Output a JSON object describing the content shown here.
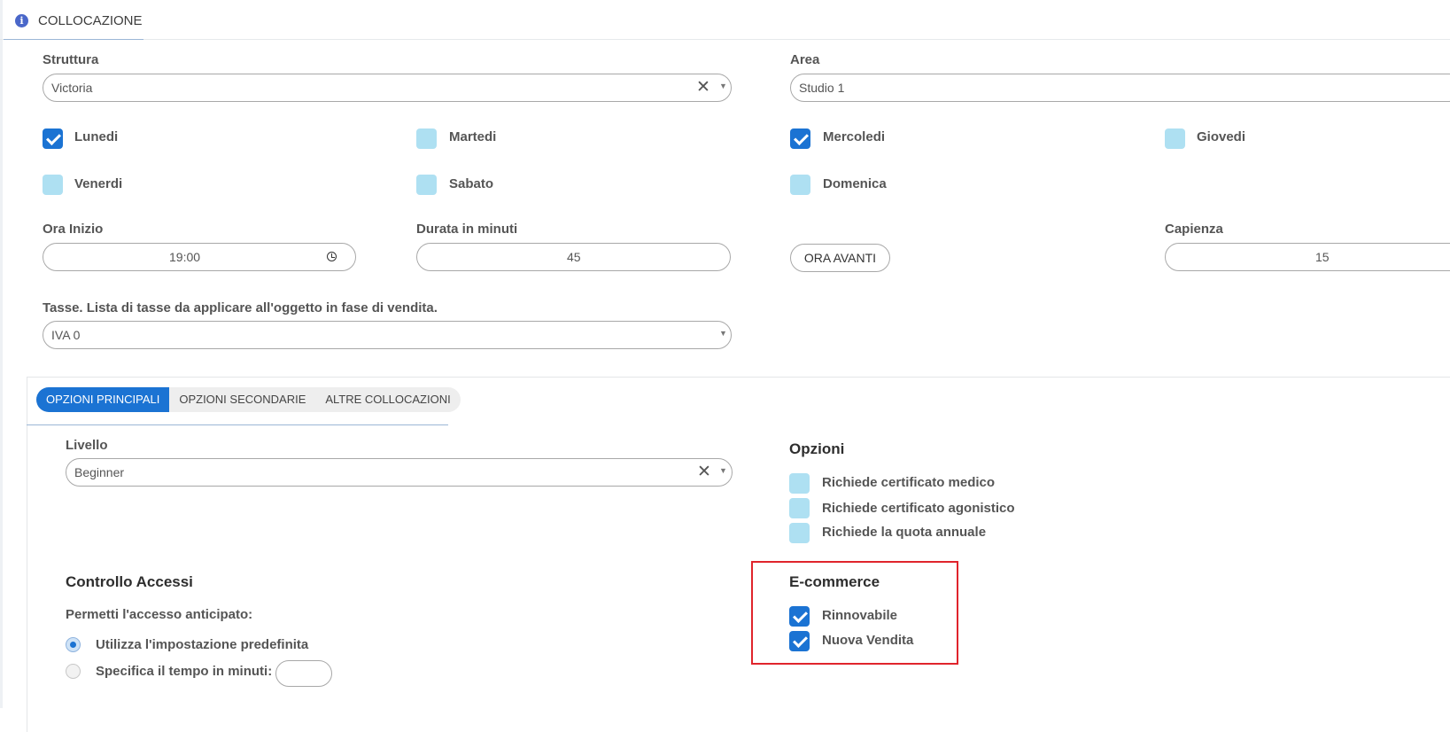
{
  "header": {
    "title": "COLLOCAZIONE",
    "icon": "info-icon"
  },
  "form": {
    "struttura": {
      "label": "Struttura",
      "value": "Victoria"
    },
    "area": {
      "label": "Area",
      "value": "Studio 1"
    },
    "days": [
      {
        "label": "Lunedi",
        "checked": true
      },
      {
        "label": "Martedi",
        "checked": false
      },
      {
        "label": "Mercoledi",
        "checked": true
      },
      {
        "label": "Giovedi",
        "checked": false
      },
      {
        "label": "Venerdi",
        "checked": false
      },
      {
        "label": "Sabato",
        "checked": false
      },
      {
        "label": "Domenica",
        "checked": false
      }
    ],
    "ora_inizio": {
      "label": "Ora Inizio",
      "value": "19:00"
    },
    "durata": {
      "label": "Durata in minuti",
      "value": "45"
    },
    "ora_avanti_button": "ORA AVANTI",
    "capienza": {
      "label": "Capienza",
      "value": "15"
    },
    "tasse": {
      "label": "Tasse. Lista di tasse da applicare all'oggetto in fase di vendita.",
      "value": "IVA 0"
    }
  },
  "tabs": [
    {
      "label": "OPZIONI PRINCIPALI",
      "active": true
    },
    {
      "label": "OPZIONI SECONDARIE",
      "active": false
    },
    {
      "label": "ALTRE COLLOCAZIONI",
      "active": false
    }
  ],
  "livello": {
    "label": "Livello",
    "value": "Beginner"
  },
  "opzioni": {
    "title": "Opzioni",
    "items": [
      {
        "label": "Richiede certificato medico",
        "checked": false
      },
      {
        "label": "Richiede certificato agonistico",
        "checked": false
      },
      {
        "label": "Richiede la quota annuale",
        "checked": false
      }
    ]
  },
  "controllo_accessi": {
    "title": "Controllo Accessi",
    "subtitle": "Permetti l'accesso anticipato:",
    "options": [
      {
        "label": "Utilizza l'impostazione predefinita",
        "selected": true
      },
      {
        "label": "Specifica il tempo in minuti:",
        "selected": false
      }
    ]
  },
  "ecommerce": {
    "title": "E-commerce",
    "items": [
      {
        "label": "Rinnovabile",
        "checked": true
      },
      {
        "label": "Nuova Vendita",
        "checked": true
      }
    ]
  },
  "colors": {
    "accent": "#1b73d3",
    "unchecked": "#aee0f2",
    "highlight": "#e0242c"
  }
}
